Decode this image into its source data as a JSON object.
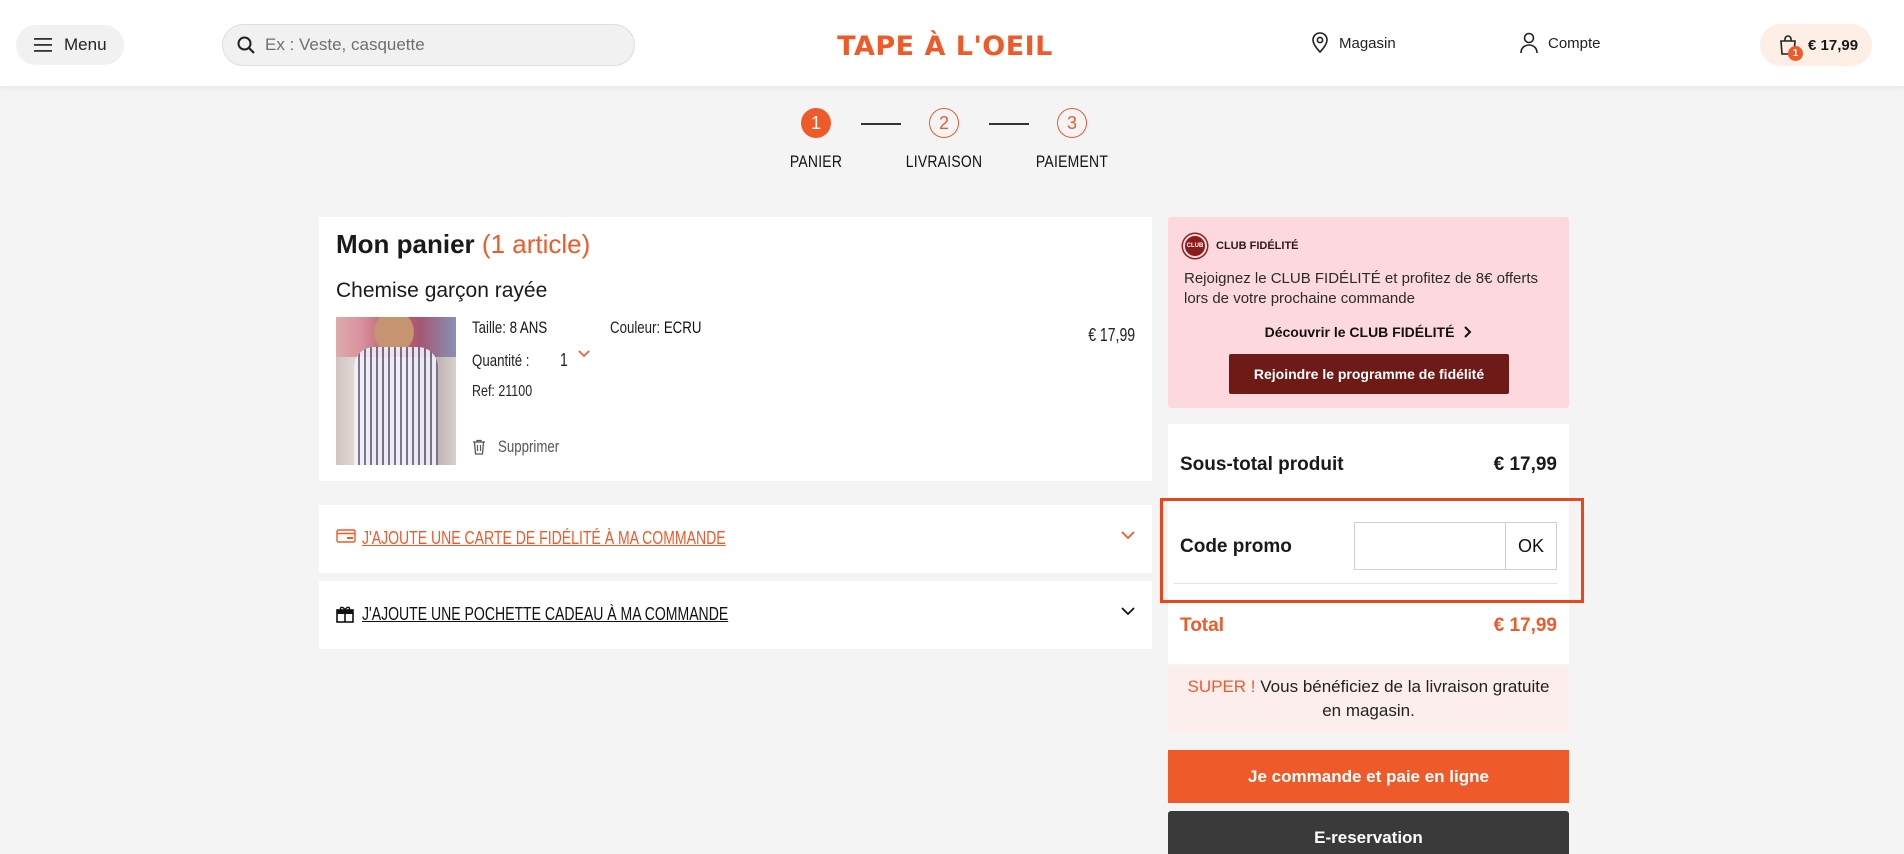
{
  "header": {
    "menu_label": "Menu",
    "search_placeholder": "Ex : Veste, casquette",
    "logo_text": "TAPE À L'OEIL",
    "store_label": "Magasin",
    "account_label": "Compte",
    "cart_badge": "1",
    "cart_total": "€ 17,99"
  },
  "steps": [
    {
      "number": "1",
      "label": "PANIER",
      "state": "active"
    },
    {
      "number": "2",
      "label": "LIVRAISON",
      "state": "todo"
    },
    {
      "number": "3",
      "label": "PAIEMENT",
      "state": "todo"
    }
  ],
  "cart": {
    "title": "Mon panier",
    "count": "(1 article)",
    "product": {
      "name": "Chemise garçon rayée",
      "size_label": "Taille:",
      "size_value": "8 ANS",
      "color_label": "Couleur:",
      "color_value": "ECRU",
      "quantity_label": "Quantité :",
      "quantity_value": "1",
      "ref": "Ref: 21100",
      "delete_label": "Supprimer",
      "price": "€ 17,99"
    }
  },
  "accordions": {
    "loyalty_card": "J'AJOUTE UNE CARTE DE FIDÉLITÉ À MA COMMANDE",
    "gift_bag": "J'AJOUTE UNE POCHETTE CADEAU À MA COMMANDE"
  },
  "club": {
    "logo_text": "CLUB",
    "title": "CLUB FIDÉLITÉ",
    "text": "Rejoignez le CLUB FIDÉLITÉ et profitez de 8€ offerts lors de votre prochaine commande",
    "link": "Découvrir le CLUB FIDÉLITÉ",
    "button": "Rejoindre le programme de fidélité"
  },
  "summary": {
    "subtotal_label": "Sous-total produit",
    "subtotal_value": "€ 17,99",
    "promo_label": "Code promo",
    "promo_value": "",
    "promo_button": "OK",
    "total_label": "Total",
    "total_value": "€ 17,99"
  },
  "delivery": {
    "super": "SUPER !",
    "text": "Vous bénéficiez de la livraison gratuite en magasin."
  },
  "actions": {
    "order_online": "Je commande et paie en ligne",
    "ereservation": "E-reservation"
  },
  "colors": {
    "accent": "#ef5a2a",
    "club_bg": "#fdd9df",
    "club_button": "#6e1b17",
    "highlight": "#e8471c"
  }
}
